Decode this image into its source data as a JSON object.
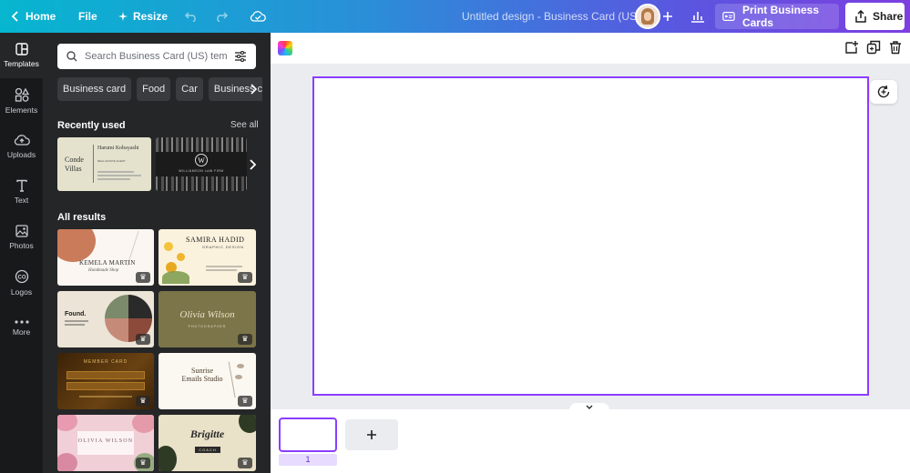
{
  "topbar": {
    "home_label": "Home",
    "file_label": "File",
    "resize_label": "Resize",
    "doc_title": "Untitled design - Business Card (US)",
    "print_label": "Print Business Cards",
    "share_label": "Share"
  },
  "rail": {
    "items": [
      {
        "label": "Templates",
        "icon": "templates-icon"
      },
      {
        "label": "Elements",
        "icon": "elements-icon"
      },
      {
        "label": "Uploads",
        "icon": "uploads-icon"
      },
      {
        "label": "Text",
        "icon": "text-icon"
      },
      {
        "label": "Photos",
        "icon": "photos-icon"
      },
      {
        "label": "Logos",
        "icon": "logos-icon"
      },
      {
        "label": "More",
        "icon": "more-icon"
      }
    ]
  },
  "panel": {
    "search_placeholder": "Search Business Card (US) templa",
    "chips": [
      "Business card",
      "Food",
      "Car",
      "Business c"
    ],
    "recent_title": "Recently used",
    "see_all": "See all",
    "recent": [
      {
        "name": "Conde Villas",
        "person": "Harumi Kobayashi",
        "role": "REAL ESTATE AGENT"
      },
      {
        "name": "W",
        "subtitle": "WILLIAMSON LAW FIRM"
      }
    ],
    "all_title": "All results",
    "results": [
      {
        "name": "KEMELA MARTIN",
        "subtitle": "Handmade Shop"
      },
      {
        "name": "SAMIRA HADID",
        "subtitle": "GRAPHIC DESIGN"
      },
      {
        "name": "Found.",
        "subtitle": ""
      },
      {
        "name": "Olivia Wilson",
        "subtitle": "PHOTOGRAPHER"
      },
      {
        "name": "MEMBER CARD",
        "subtitle": ""
      },
      {
        "name": "Sunrise Emails Studio",
        "subtitle": ""
      },
      {
        "name": "OLIVIA WILSON",
        "subtitle": ""
      },
      {
        "name": "Brigitte",
        "subtitle": "COACH"
      }
    ]
  },
  "canvas": {
    "page_number": "1",
    "brand_color": "#8b3dff"
  }
}
